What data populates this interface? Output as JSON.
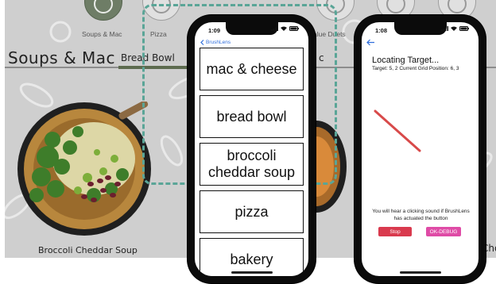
{
  "kiosk": {
    "categories": [
      "Soups & Mac",
      "Pizza",
      "Value Duets"
    ],
    "section_title": "Soups & Mac",
    "active_tab": "Bread Bowl",
    "stray_tab_fragment": "c",
    "dish_caption": "Broccoli Cheddar Soup",
    "edge_caption": "Cho"
  },
  "phone_list": {
    "time": "1:09",
    "back_label": "BrushLens",
    "items": [
      "mac & cheese",
      "bread bowl",
      "broccoli cheddar soup",
      "pizza",
      "bakery"
    ]
  },
  "phone_locate": {
    "time": "1:08",
    "title": "Locating Target...",
    "info": "Target: 5, 2  Current Grid Position: 6, 3",
    "note": "You will hear a clicking sound if BrushLens has actuated the button",
    "stop_label": "Stop",
    "ok_label": "OK-DEBUG",
    "colors": {
      "stop": "#d93a4e",
      "ok": "#df4ba6",
      "pointer_line": "#d84a4a",
      "back_arrow": "#2f6edb"
    }
  }
}
